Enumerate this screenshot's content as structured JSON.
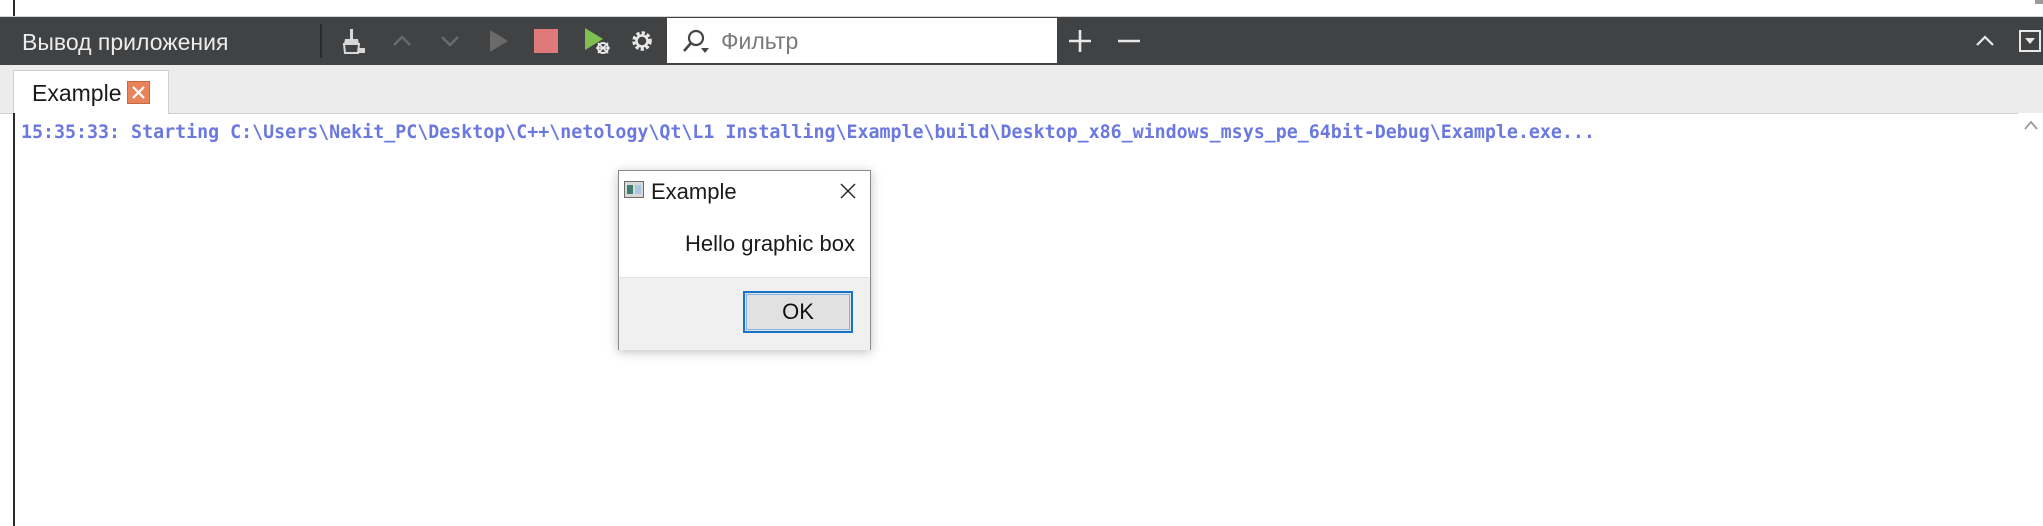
{
  "toolbar": {
    "title": "Вывод приложения",
    "filter_placeholder": "Фильтр",
    "icons": [
      "clean-icon",
      "up-arrow-icon",
      "down-arrow-icon",
      "run-icon",
      "stop-icon",
      "debug-run-icon",
      "settings-icon",
      "add-icon",
      "remove-icon",
      "collapse-icon",
      "menu-icon"
    ],
    "colors": {
      "background": "#404244",
      "stop": "#e07a7a",
      "run": "#7fbf4f"
    }
  },
  "tab": {
    "label": "Example",
    "close_color": "#e8835a"
  },
  "output": {
    "line": "15:35:33: Starting C:\\Users\\Nekit_PC\\Desktop\\C++\\netology\\Qt\\L1 Installing\\Example\\build\\Desktop_x86_windows_msys_pe_64bit-Debug\\Example.exe...",
    "color": "#6b78e0"
  },
  "dialog": {
    "title": "Example",
    "message": "Hello graphic box",
    "ok_label": "OK",
    "accent": "#1a72c8"
  }
}
